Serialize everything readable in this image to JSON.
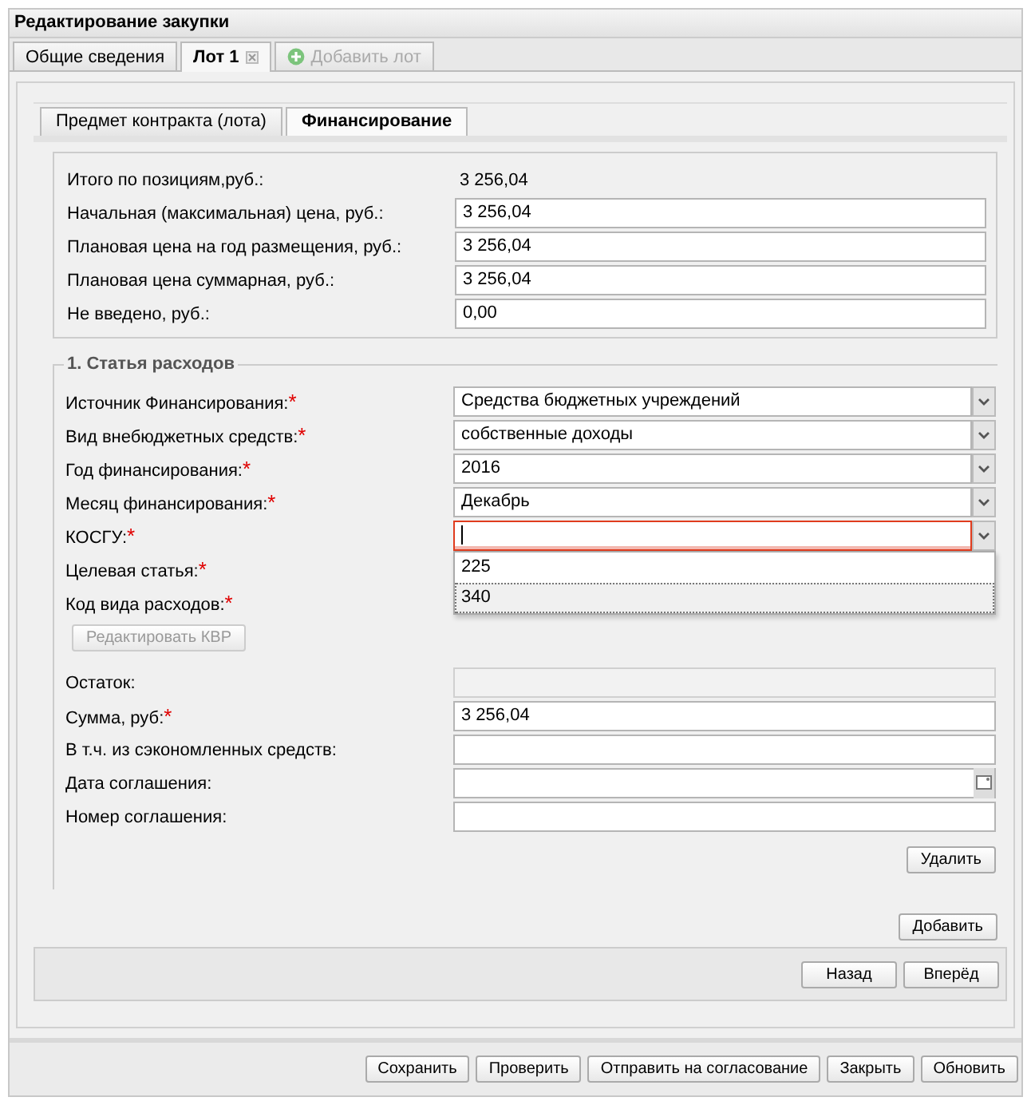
{
  "window": {
    "title": "Редактирование закупки"
  },
  "tabs": [
    {
      "label": "Общие сведения",
      "selected": false,
      "closable": false,
      "disabled": false
    },
    {
      "label": "Лот 1",
      "selected": true,
      "closable": true,
      "disabled": false
    },
    {
      "label": "Добавить лот",
      "selected": false,
      "closable": false,
      "disabled": true,
      "kind": "add"
    }
  ],
  "subtabs": [
    {
      "label": "Предмет контракта (лота)",
      "selected": false
    },
    {
      "label": "Финансирование",
      "selected": true
    }
  ],
  "summary": [
    {
      "label": "Итого по позициям,руб.:",
      "value": "3 256,04",
      "kind": "text"
    },
    {
      "label": "Начальная (максимальная) цена, руб.:",
      "value": "3 256,04",
      "kind": "input"
    },
    {
      "label": "Плановая цена на год размещения, руб.:",
      "value": "3 256,04",
      "kind": "input"
    },
    {
      "label": "Плановая цена суммарная, руб.:",
      "value": "3 256,04",
      "kind": "input"
    },
    {
      "label": "Не введено, руб.:",
      "value": "0,00",
      "kind": "input"
    }
  ],
  "expense": {
    "legend": "1. Статья расходов",
    "fields": [
      {
        "label": "Источник Финансирования:",
        "required_mark": "*",
        "kind": "combo",
        "value": "Средства бюджетных учреждений"
      },
      {
        "label": "Вид внебюджетных средств:",
        "required_mark": "*",
        "kind": "combo",
        "value": "собственные доходы"
      },
      {
        "label": "Год финансирования:",
        "required_mark": "*",
        "kind": "combo",
        "value": "2016"
      },
      {
        "label": "Месяц финансирования:",
        "required_mark": "*",
        "kind": "combo",
        "value": "Декабрь"
      },
      {
        "label": "КОСГУ:",
        "required_mark": "*",
        "kind": "combo",
        "focused": true,
        "invalid": true,
        "options": [
          {
            "label": "225",
            "selected": false
          },
          {
            "label": "340",
            "selected": true
          }
        ]
      },
      {
        "label": "Целевая статья:",
        "required_mark": "*",
        "kind": "hidden"
      },
      {
        "label": "Код вида расходов:",
        "required_mark": "*",
        "kind": "hidden"
      }
    ],
    "edit_button": {
      "label": "Редактировать КВР",
      "disabled": true
    },
    "fields2": [
      {
        "label": "Остаток:",
        "kind": "readonly"
      },
      {
        "label": "Сумма, руб:",
        "required_mark": "*",
        "kind": "input",
        "value": "3 256,04"
      },
      {
        "label": "В т.ч. из сэкономленных средств:",
        "kind": "input"
      },
      {
        "label": "Дата соглашения:",
        "kind": "date"
      },
      {
        "label": "Номер соглашения:",
        "kind": "input"
      }
    ],
    "delete_button": "Удалить"
  },
  "add_button": "Добавить",
  "nav_buttons": [
    "Назад",
    "Вперёд"
  ],
  "footer_buttons": [
    "Сохранить",
    "Проверить",
    "Отправить на согласование",
    "Закрыть",
    "Обновить"
  ]
}
